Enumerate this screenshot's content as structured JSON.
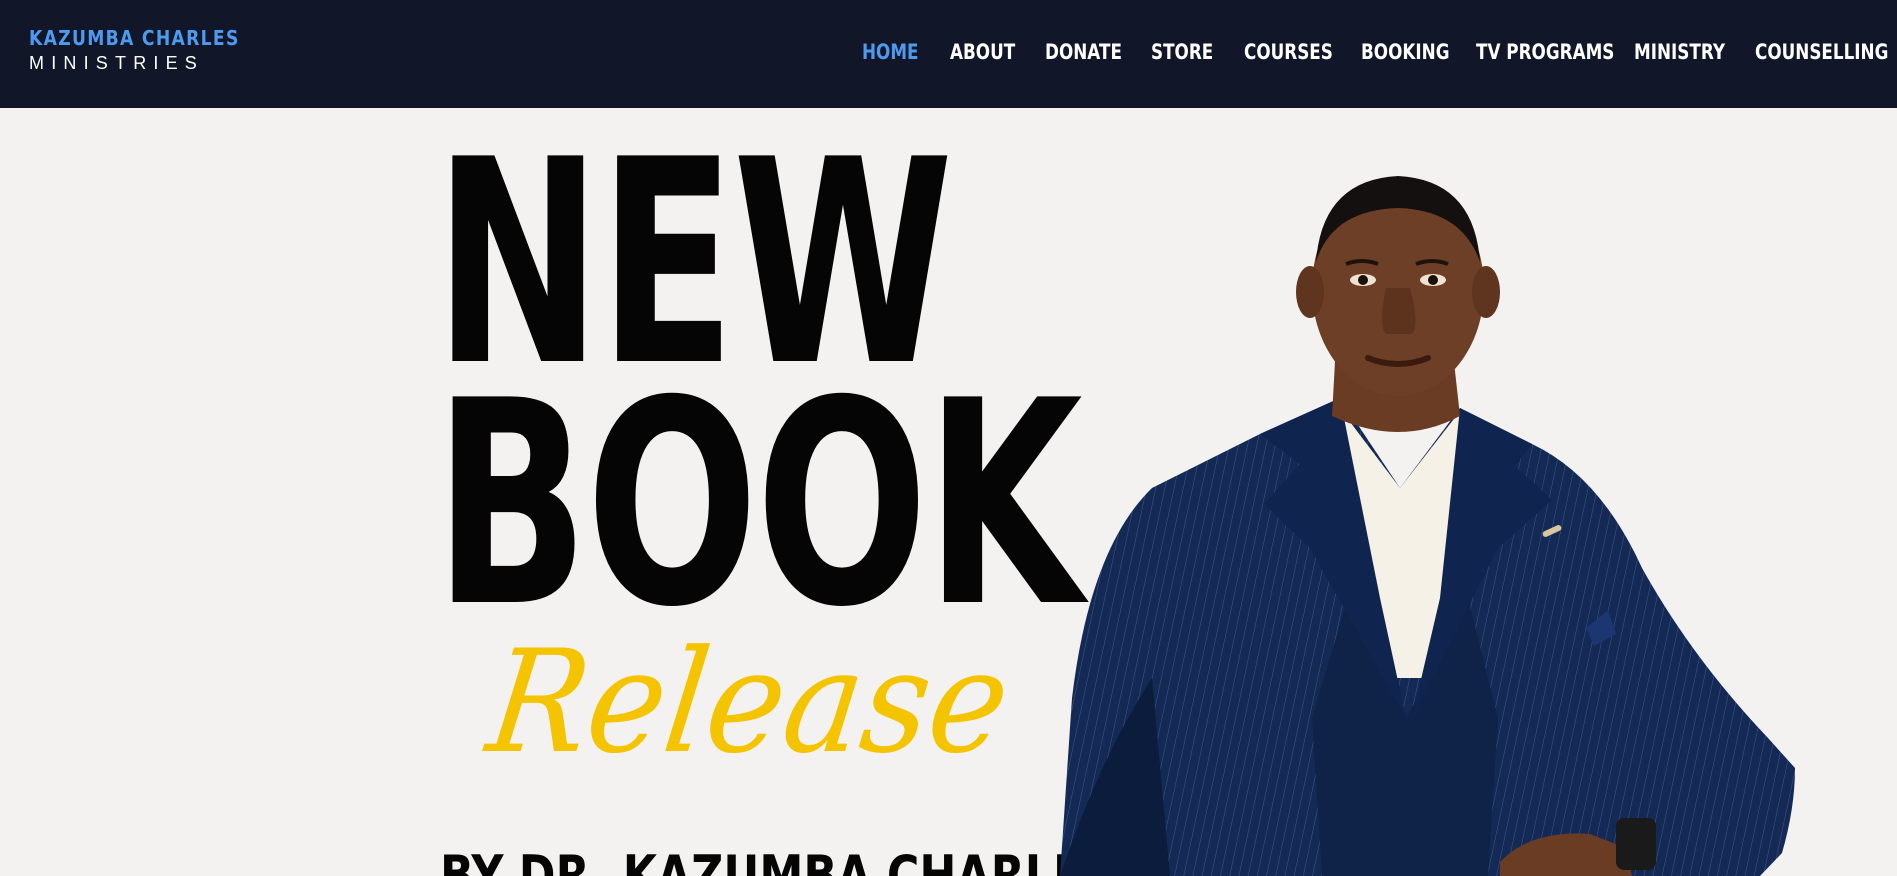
{
  "brand": {
    "name_top": "KAZUMBA CHARLES",
    "name_bottom": "MINISTRIES",
    "accent_color": "#4d9bf0",
    "nav_background": "#111729"
  },
  "nav": {
    "items": [
      {
        "label": "HOME",
        "active": true
      },
      {
        "label": "ABOUT",
        "active": false
      },
      {
        "label": "DONATE",
        "active": false
      },
      {
        "label": "STORE",
        "active": false
      },
      {
        "label": "COURSES",
        "active": false
      },
      {
        "label": "BOOKING",
        "active": false
      },
      {
        "label": "TV PROGRAMS",
        "active": false
      },
      {
        "label": "MINISTRY",
        "active": false
      },
      {
        "label": "COUNSELLING",
        "active": false
      }
    ]
  },
  "hero": {
    "line1": "NEW",
    "line2": "BOOK",
    "script": "Release",
    "byline": "BY DR. KAZUMBA CHARLES",
    "background": "#f3f2f1",
    "script_color": "#f5c400",
    "portrait_icon": "man-in-navy-pinstripe-suit-photo"
  }
}
